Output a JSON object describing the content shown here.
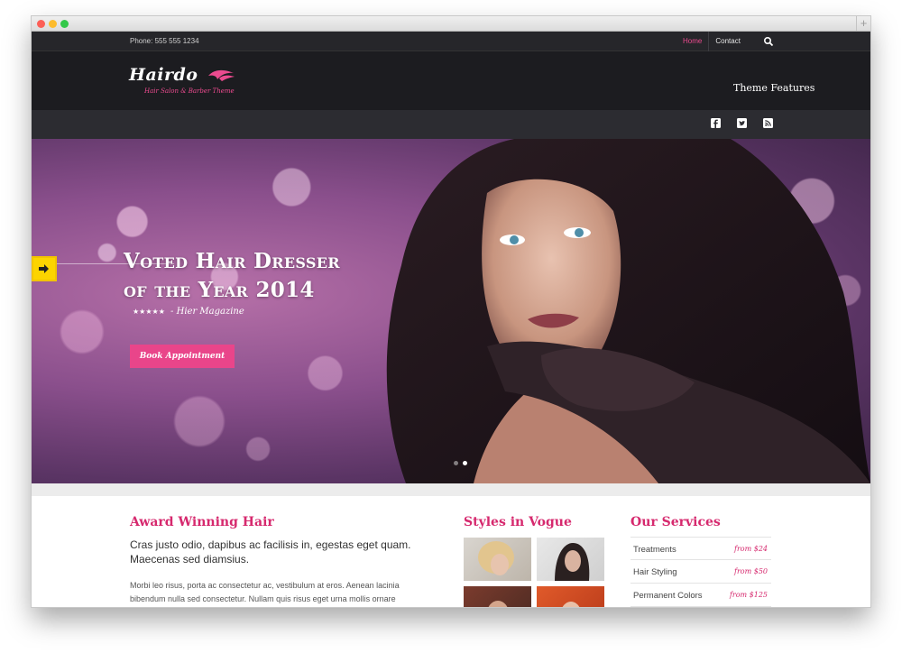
{
  "topbar": {
    "phone": "Phone: 555 555 1234",
    "nav": [
      {
        "label": "Home",
        "active": true
      },
      {
        "label": "Contact",
        "active": false
      }
    ],
    "search_icon": "search-icon"
  },
  "header": {
    "logo_text": "Hairdo",
    "logo_tagline": "Hair Salon & Barber Theme",
    "menu_item": "Theme Features"
  },
  "social": [
    "facebook-icon",
    "twitter-icon",
    "rss-icon"
  ],
  "hero": {
    "title_line1": "Voted Hair Dresser",
    "title_line2": "of the Year 2014",
    "rating": "★★★★★",
    "quote_source": "- Hier Magazine",
    "cta": "Book Appointment",
    "slides": 2,
    "active_slide": 2
  },
  "award": {
    "title": "Award Winning Hair",
    "lead": "Cras justo odio, dapibus ac facilisis in, egestas eget quam. Maecenas sed diamsius.",
    "body": "Morbi leo risus, porta ac consectetur ac, vestibulum at eros. Aenean lacinia bibendum nulla sed consectetur. Nullam quis risus eget urna mollis ornare"
  },
  "vogue": {
    "title": "Styles in Vogue"
  },
  "services": {
    "title": "Our Services",
    "items": [
      {
        "name": "Treatments",
        "price": "from $24"
      },
      {
        "name": "Hair Styling",
        "price": "from $50"
      },
      {
        "name": "Permanent Colors",
        "price": "from $125"
      }
    ]
  },
  "colors": {
    "accent": "#e9458a",
    "header_bg": "#1c1c20",
    "topbar_bg": "#26262a",
    "slide_tab": "#fcd400"
  }
}
